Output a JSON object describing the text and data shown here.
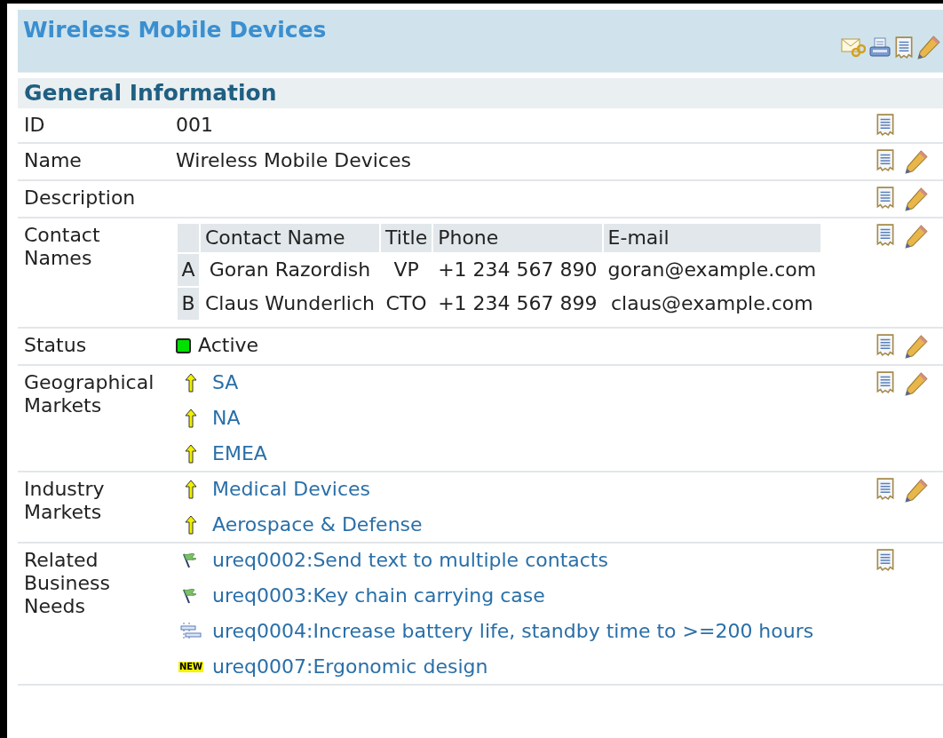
{
  "header": {
    "title": "Wireless Mobile Devices"
  },
  "section": {
    "title": "General Information"
  },
  "rows": [
    {
      "kind": "text",
      "label": "ID",
      "value": "001",
      "editable": false
    },
    {
      "kind": "text",
      "label": "Name",
      "value": "Wireless Mobile Devices",
      "editable": true
    },
    {
      "kind": "text",
      "label": "Description",
      "editable": true
    },
    {
      "kind": "contacts",
      "label": "Contact Names",
      "editable": true,
      "columns": [
        "Contact Name",
        "Title",
        "Phone",
        "E-mail"
      ],
      "contacts": [
        {
          "key": "A",
          "cells": [
            "Goran Razordish",
            "VP",
            "+1 234 567 890",
            "goran@example.com"
          ]
        },
        {
          "key": "B",
          "cells": [
            "Claus Wunderlich",
            "CTO",
            "+1 234 567 899",
            "claus@example.com"
          ]
        }
      ]
    },
    {
      "kind": "status",
      "label": "Status",
      "value": "Active",
      "color": "#00e000",
      "editable": true
    },
    {
      "kind": "links",
      "label": "Geographical Markets",
      "editable": true,
      "items": [
        {
          "kind": "arrow",
          "text": "SA"
        },
        {
          "kind": "arrow",
          "text": "NA"
        },
        {
          "kind": "arrow",
          "text": "EMEA"
        }
      ]
    },
    {
      "kind": "links",
      "label": "Industry Markets",
      "editable": true,
      "items": [
        {
          "kind": "arrow",
          "text": "Medical Devices"
        },
        {
          "kind": "arrow",
          "text": "Aerospace & Defense"
        }
      ]
    },
    {
      "kind": "links",
      "label": "Related Business Needs",
      "editable": false,
      "items": [
        {
          "kind": "flag",
          "text": "ureq0002:Send text to multiple contacts"
        },
        {
          "kind": "flag",
          "text": "ureq0003:Key chain carrying case"
        },
        {
          "kind": "tree",
          "text": "ureq0004:Increase battery life, standby time to >=200 hours"
        },
        {
          "kind": "new",
          "badge": "NEW",
          "text": "ureq0007:Ergonomic design"
        }
      ]
    }
  ]
}
